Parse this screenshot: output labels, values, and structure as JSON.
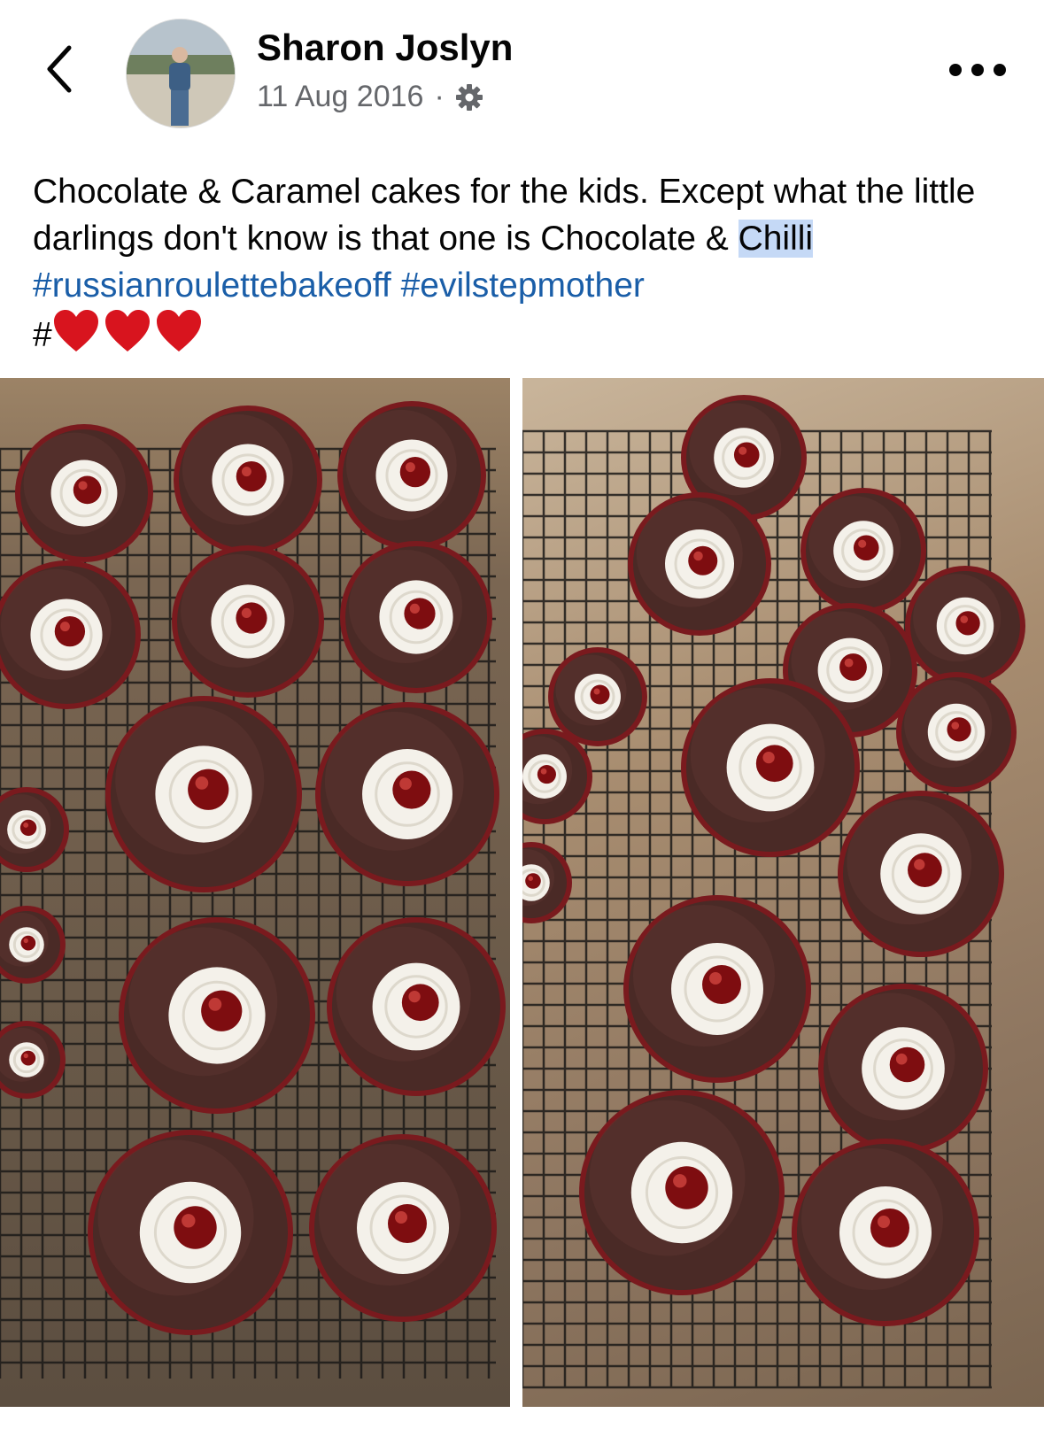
{
  "post": {
    "author": "Sharon Joslyn",
    "date": "11 Aug 2016",
    "separator": "·",
    "privacy_icon": "gear-icon",
    "caption_text": "Chocolate & Caramel cakes for the kids. Except what the little darlings don't know is that one is Chocolate & ",
    "caption_highlight": "Chilli",
    "hashtags": [
      "#russianroulettebakeoff",
      "#evilstepmother"
    ],
    "hash_prefix": "#",
    "emoji": [
      "heart",
      "heart",
      "heart"
    ]
  },
  "photos": [
    {
      "description_icon": "cupcakes-photo-left"
    },
    {
      "description_icon": "cupcakes-photo-right"
    }
  ],
  "colors": {
    "hashtag": "#1a5ea8",
    "highlight": "#c5d9f6",
    "meta": "#65676b",
    "heart": "#d8141e"
  }
}
